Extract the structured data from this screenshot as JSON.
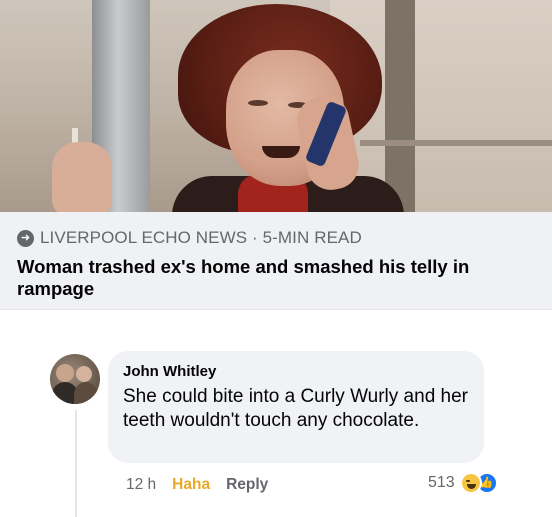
{
  "preview": {
    "source_icon": "link-icon",
    "source": "LIVERPOOL ECHO NEWS · 5-MIN READ",
    "headline": "Woman trashed ex's home and smashed his telly in rampage"
  },
  "comment": {
    "author": "John Whitley",
    "text": "She could bite into a Curly Wurly and her teeth wouldn't touch any chocolate.",
    "time": "12 h",
    "haha_label": "Haha",
    "reply_label": "Reply",
    "reaction_count": "513",
    "reaction_icons": [
      "haha-icon",
      "like-icon"
    ]
  },
  "colors": {
    "meta_bg": "#eff1f4",
    "bubble_bg": "#f0f2f5",
    "haha": "#e8a92b",
    "like": "#1877f2",
    "secondary_text": "#65676b"
  }
}
